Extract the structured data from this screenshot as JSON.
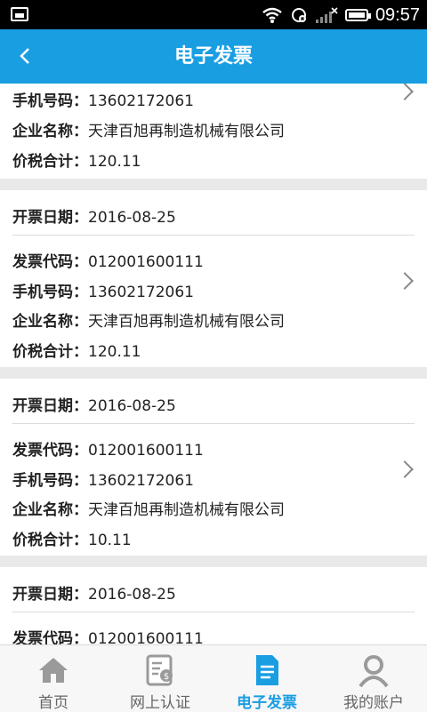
{
  "status_bar": {
    "time": "09:57"
  },
  "header": {
    "title": "电子发票",
    "back_icon": "chevron-left-icon"
  },
  "labels": {
    "date": "开票日期：",
    "code": "发票代码：",
    "phone": "手机号码：",
    "company": "企业名称：",
    "total": "价税合计："
  },
  "invoices": [
    {
      "phone": "13602172061",
      "company": "天津百旭再制造机械有限公司",
      "total": "120.11"
    },
    {
      "date": "2016-08-25",
      "code": "012001600111",
      "phone": "13602172061",
      "company": "天津百旭再制造机械有限公司",
      "total": "120.11"
    },
    {
      "date": "2016-08-25",
      "code": "012001600111",
      "phone": "13602172061",
      "company": "天津百旭再制造机械有限公司",
      "total": "10.11"
    },
    {
      "date": "2016-08-25",
      "code": "012001600111"
    }
  ],
  "tabs": [
    {
      "label": "首页",
      "icon": "home-icon"
    },
    {
      "label": "网上认证",
      "icon": "certificate-icon"
    },
    {
      "label": "电子发票",
      "icon": "invoice-document-icon",
      "active": true
    },
    {
      "label": "我的账户",
      "icon": "account-person-icon"
    }
  ],
  "colors": {
    "accent": "#1a9ee2",
    "statusbar": "#000000",
    "background": "#e9e9e9"
  }
}
